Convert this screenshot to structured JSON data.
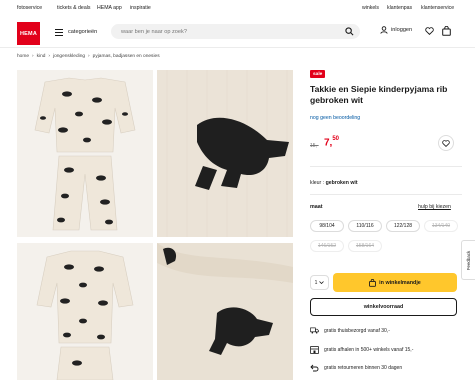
{
  "util_nav": {
    "left": [
      "fotoservice",
      "tickets & deals",
      "HEMA app",
      "inspiratie"
    ],
    "right": [
      "winkels",
      "klantenpas",
      "klantenservice"
    ]
  },
  "header": {
    "logo_text": "HEMA",
    "menu_label": "categorieën",
    "search_placeholder": "waar ben je naar op zoek?",
    "login_label": "inloggen"
  },
  "breadcrumb": [
    "home",
    "kind",
    "jongenskleding",
    "pyjamas, badjassen en onesies"
  ],
  "product": {
    "badge": "sale",
    "title": "Takkie en Siepie kinderpyjama rib gebroken wit",
    "rating": "nog geen beoordeling",
    "old_price": "15,-",
    "price_whole": "7,",
    "price_cents": "50",
    "color_label": "kleur",
    "color_value": "gebroken wit",
    "size_label": "maat",
    "size_help": "hulp bij kiezen",
    "sizes_row1": [
      "98/104",
      "110/116",
      "122/128",
      "134/140"
    ],
    "sizes_row2": [
      "146/152",
      "158/164"
    ],
    "quantity": "1",
    "cart_button": "in winkelmandje",
    "store_button": "winkelvoorraad",
    "usps": [
      "gratis thuisbezorgd vanaf 30,-",
      "gratis afhalen in 500+ winkels vanaf 15,-",
      "gratis retourneren binnen 30 dagen"
    ]
  },
  "feedback_tab": "Feedback",
  "colors": {
    "brand_red": "#e2001a",
    "cart_yellow": "#ffc72c"
  }
}
